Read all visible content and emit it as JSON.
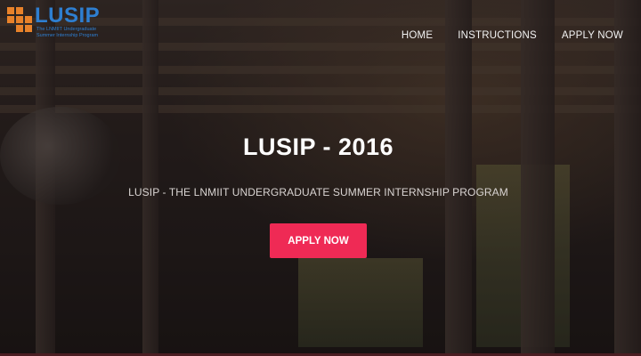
{
  "logo": {
    "title": "LUSIP",
    "subtitle": "The LNMIIT Undergraduate\nSummer Internship Program"
  },
  "nav": {
    "items": [
      "HOME",
      "INSTRUCTIONS",
      "APPLY NOW"
    ]
  },
  "hero": {
    "title": "LUSIP - 2016",
    "subtitle": "LUSIP - THE LNMIIT UNDERGRADUATE SUMMER INTERNSHIP PROGRAM",
    "cta_label": "APPLY NOW"
  },
  "colors": {
    "logo_orange": "#e8822a",
    "logo_blue": "#2e7fd1",
    "cta_pink": "#ef2a55"
  }
}
